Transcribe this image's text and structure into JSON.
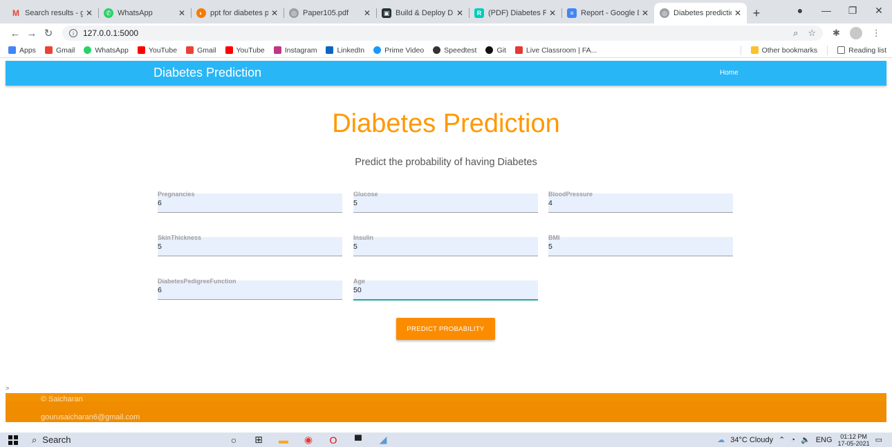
{
  "browser": {
    "tabs": [
      {
        "title": "Search results - g",
        "icon": "gmail-icon",
        "color": "#ea4335",
        "glyph": "M",
        "active": false
      },
      {
        "title": "WhatsApp",
        "icon": "whatsapp-icon",
        "color": "#25d366",
        "glyph": "✆",
        "active": false
      },
      {
        "title": "ppt for diabetes p",
        "icon": "search-result-icon",
        "color": "#f57c00",
        "glyph": "◐",
        "active": false
      },
      {
        "title": "Paper105.pdf",
        "icon": "globe-icon",
        "color": "#5f6368",
        "glyph": "◎",
        "active": false
      },
      {
        "title": "Build & Deploy D",
        "icon": "video-icon",
        "color": "#263238",
        "glyph": "▣",
        "active": false
      },
      {
        "title": "(PDF) Diabetes Pr",
        "icon": "researchgate-icon",
        "color": "#00ccbb",
        "glyph": "R",
        "active": false
      },
      {
        "title": "Report - Google D",
        "icon": "google-docs-icon",
        "color": "#4285f4",
        "glyph": "≡",
        "active": false
      },
      {
        "title": "Diabetes predictio",
        "icon": "globe-icon",
        "color": "#5f6368",
        "glyph": "◎",
        "active": true
      }
    ],
    "url": "127.0.0.1:5000",
    "bookmarks": [
      {
        "label": "Apps",
        "color": "#4285f4"
      },
      {
        "label": "Gmail",
        "color": "#ea4335"
      },
      {
        "label": "WhatsApp",
        "color": "#25d366"
      },
      {
        "label": "YouTube",
        "color": "#ff0000"
      },
      {
        "label": "Gmail",
        "color": "#ea4335"
      },
      {
        "label": "YouTube",
        "color": "#ff0000"
      },
      {
        "label": "Instagram",
        "color": "#c13584"
      },
      {
        "label": "LinkedIn",
        "color": "#0a66c2"
      },
      {
        "label": "Prime Video",
        "color": "#1a98ff"
      },
      {
        "label": "Speedtest",
        "color": "#333333"
      },
      {
        "label": "Git",
        "color": "#111111"
      },
      {
        "label": "Live Classroom | FA...",
        "color": "#e53935"
      }
    ],
    "other_bookmarks": "Other bookmarks",
    "reading_list": "Reading list"
  },
  "navbar": {
    "brand": "Diabetes Prediction",
    "home": "Home",
    "color": "#29b6f6"
  },
  "hero": {
    "title": "Diabetes Prediction",
    "subtitle": "Predict the probability of having Diabetes"
  },
  "form": {
    "fields": [
      {
        "label": "Pregnancies",
        "value": "6"
      },
      {
        "label": "Glucose",
        "value": "5"
      },
      {
        "label": "BloodPressure",
        "value": "4"
      },
      {
        "label": "SkinThickness",
        "value": "5"
      },
      {
        "label": "Insulin",
        "value": "5"
      },
      {
        "label": "BMI",
        "value": "5"
      },
      {
        "label": "DiabetesPedigreeFunction",
        "value": "6"
      },
      {
        "label": "Age",
        "value": "50"
      }
    ],
    "button": "PREDICT PROBABILITY"
  },
  "stray_char": ">",
  "footer": {
    "copyright": "© Saicharan",
    "email": "gourusaicharan6@gmail.com"
  },
  "taskbar": {
    "search": "Search",
    "weather": "34°C Cloudy",
    "lang": "ENG",
    "time": "01:12 PM",
    "date": "17-05-2021"
  },
  "colors": {
    "accent_orange": "#ff9800",
    "button_orange": "#fb8c00",
    "footer_orange": "#ef8c00"
  }
}
